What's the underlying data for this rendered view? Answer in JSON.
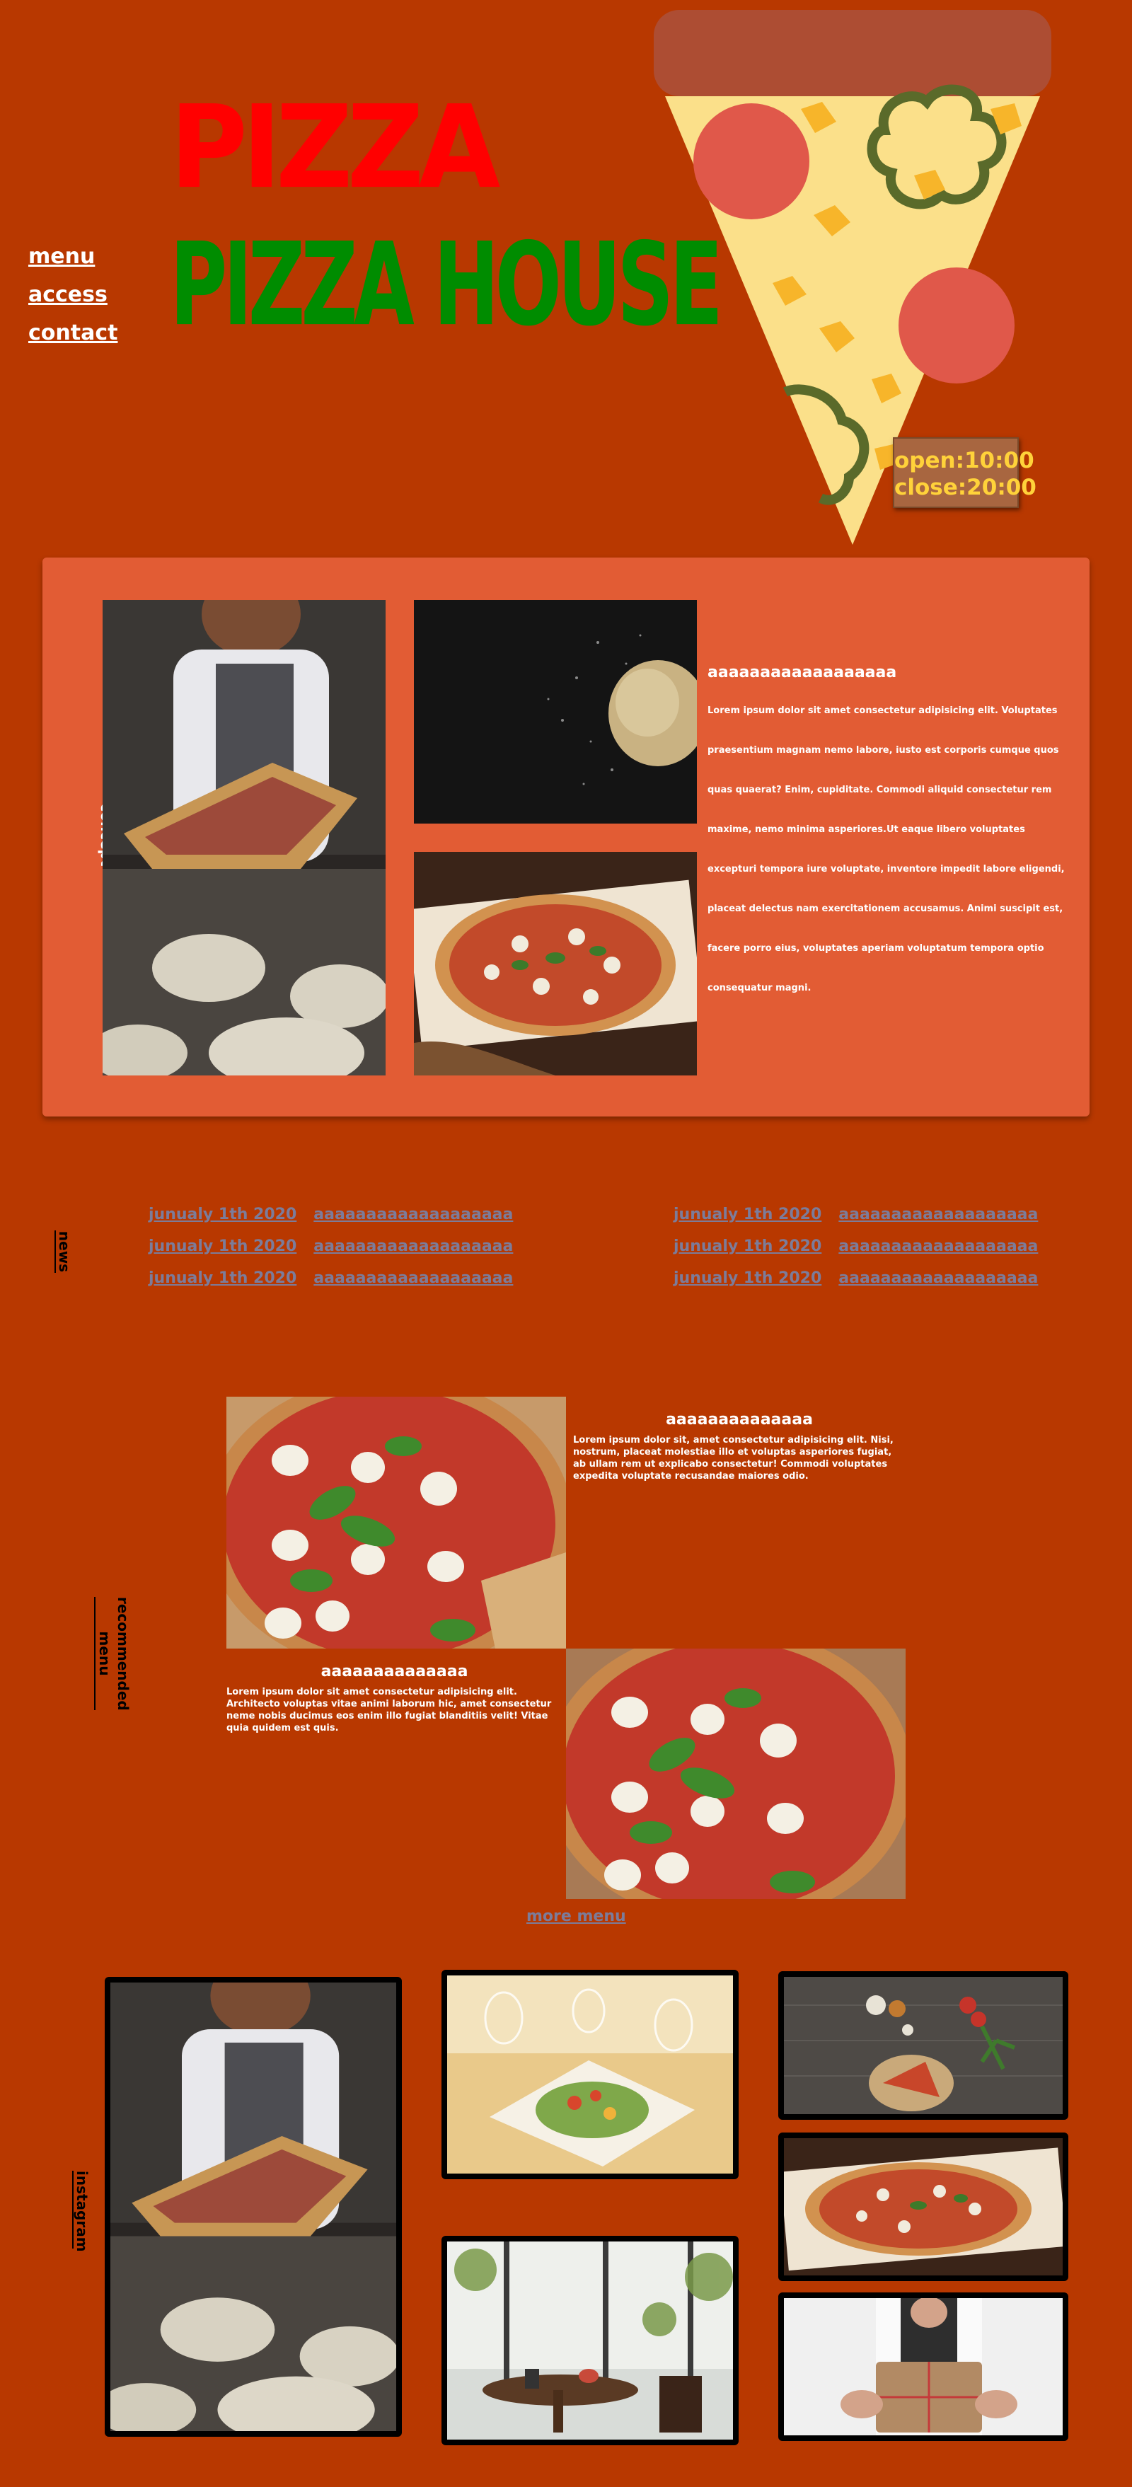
{
  "nav": {
    "menu": "menu",
    "access": "access",
    "contact": "contact"
  },
  "header": {
    "title_line_1": "PIZZA",
    "title_line_2": "PIZZA HOUSE",
    "hours_open": "open:10:00",
    "hours_close": "close:20:00"
  },
  "concept": {
    "label": "concept",
    "heading": "aaaaaaaaaaaaaaaaaa",
    "body": "Lorem ipsum dolor sit amet consectetur adipisicing elit. Voluptates praesentium magnam nemo labore, iusto est corporis cumque quos quas quaerat? Enim, cupiditate. Commodi aliquid consectetur rem maxime, nemo minima asperiores.Ut eaque libero voluptates excepturi tempora iure voluptate, inventore impedit labore eligendi, placeat delectus nam exercitationem accusamus. Animi suscipit est, facere porro eius, voluptates aperiam voluptatum tempora optio consequatur magni."
  },
  "news": {
    "label": "news",
    "items_left": [
      {
        "date": "junualy 1th 2020",
        "title": "aaaaaaaaaaaaaaaaaaa"
      },
      {
        "date": "junualy 1th 2020",
        "title": "aaaaaaaaaaaaaaaaaaa"
      },
      {
        "date": "junualy 1th 2020",
        "title": "aaaaaaaaaaaaaaaaaaa"
      }
    ],
    "items_right": [
      {
        "date": "junualy 1th 2020",
        "title": "aaaaaaaaaaaaaaaaaaa"
      },
      {
        "date": "junualy 1th 2020",
        "title": "aaaaaaaaaaaaaaaaaaa"
      },
      {
        "date": "junualy 1th 2020",
        "title": "aaaaaaaaaaaaaaaaaaa"
      }
    ]
  },
  "recommended": {
    "label": "recommended menu",
    "item1_heading": "aaaaaaaaaaaaaa",
    "item1_body": "Lorem ipsum dolor sit, amet consectetur adipisicing elit. Nisi, nostrum, placeat molestiae illo et voluptas asperiores fugiat, ab ullam rem ut explicabo consectetur! Commodi voluptates expedita voluptate recusandae maiores odio.",
    "item2_heading": "aaaaaaaaaaaaaa",
    "item2_body": "Lorem ipsum dolor sit amet consectetur adipisicing elit. Architecto voluptas vitae animi laborum hic, amet consectetur neme nobis ducimus eos enim illo fugiat blanditiis velit! Vitae quia quidem est quis.",
    "more_menu": "more menu"
  },
  "instagram": {
    "label": "instagram"
  },
  "colors": {
    "background": "#b83800",
    "panel": "#e25c34",
    "title_red": "#ff0000",
    "title_green": "#008c00",
    "hours_text": "#ffd23a",
    "link_muted": "#7c7c9a"
  }
}
